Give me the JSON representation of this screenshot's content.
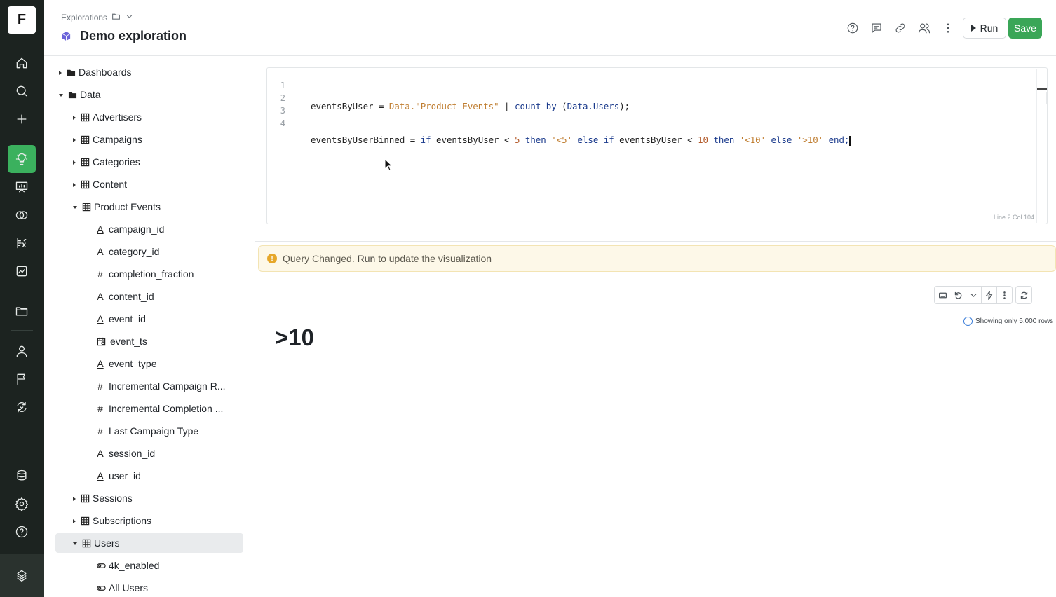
{
  "rail": {
    "logo_letter": "F",
    "items": [
      {
        "name": "home-icon"
      },
      {
        "name": "search-icon"
      },
      {
        "name": "plus-icon"
      },
      {
        "name": "lightbulb-icon",
        "active": true
      },
      {
        "name": "presentation-icon"
      },
      {
        "name": "overlap-icon"
      },
      {
        "name": "formula-icon"
      },
      {
        "name": "chart-icon"
      },
      {
        "name": "folder-icon"
      },
      {
        "name": "user-icon"
      },
      {
        "name": "flag-icon"
      },
      {
        "name": "workflow-icon"
      },
      {
        "name": "database-icon"
      },
      {
        "name": "gear-icon"
      },
      {
        "name": "help-icon"
      },
      {
        "name": "brand-icon"
      }
    ],
    "active_color": "#3bb15e"
  },
  "header": {
    "breadcrumb": "Explorations",
    "title": "Demo exploration",
    "icons": [
      "help-icon",
      "comment-icon",
      "link-icon",
      "users-icon",
      "more-icon"
    ],
    "run_label": "Run",
    "save_label": "Save",
    "save_color": "#3aa657"
  },
  "tree": {
    "rows": [
      {
        "label": "Dashboards",
        "caret": "right",
        "kind": "folder",
        "indent": 0
      },
      {
        "label": "Data",
        "caret": "down",
        "kind": "folder-open",
        "indent": 0
      },
      {
        "label": "Advertisers",
        "caret": "right",
        "kind": "table",
        "indent": 1
      },
      {
        "label": "Campaigns",
        "caret": "right",
        "kind": "table",
        "indent": 1
      },
      {
        "label": "Categories",
        "caret": "right",
        "kind": "table",
        "indent": 1
      },
      {
        "label": "Content",
        "caret": "right",
        "kind": "table",
        "indent": 1
      },
      {
        "label": "Product Events",
        "caret": "down",
        "kind": "table",
        "indent": 1
      },
      {
        "label": "campaign_id",
        "kind": "string",
        "indent": 2
      },
      {
        "label": "category_id",
        "kind": "string",
        "indent": 2
      },
      {
        "label": "completion_fraction",
        "kind": "number",
        "indent": 2
      },
      {
        "label": "content_id",
        "kind": "string",
        "indent": 2
      },
      {
        "label": "event_id",
        "kind": "string",
        "indent": 2
      },
      {
        "label": "event_ts",
        "kind": "datetime",
        "indent": 2
      },
      {
        "label": "event_type",
        "kind": "string",
        "indent": 2
      },
      {
        "label": "Incremental Campaign R...",
        "kind": "number",
        "indent": 2
      },
      {
        "label": "Incremental Completion ...",
        "kind": "number",
        "indent": 2
      },
      {
        "label": "Last Campaign Type",
        "kind": "number",
        "indent": 2
      },
      {
        "label": "session_id",
        "kind": "string",
        "indent": 2
      },
      {
        "label": "user_id",
        "kind": "string",
        "indent": 2
      },
      {
        "label": "Sessions",
        "caret": "right",
        "kind": "table",
        "indent": 1
      },
      {
        "label": "Subscriptions",
        "caret": "right",
        "kind": "table",
        "indent": 1
      },
      {
        "label": "Users",
        "caret": "down",
        "kind": "table",
        "indent": 1,
        "selected": true
      },
      {
        "label": "4k_enabled",
        "kind": "boolean",
        "indent": 2
      },
      {
        "label": "All Users",
        "kind": "boolean",
        "indent": 2
      }
    ]
  },
  "editor": {
    "line_numbers": [
      "1",
      "2",
      "3",
      "4"
    ],
    "line1": {
      "a": "eventsByUser",
      "b": " = ",
      "c": "Data.",
      "d": "\"Product Events\"",
      "e": " | ",
      "f": "count by",
      "g": " (",
      "h": "Data.Users",
      "i": ");"
    },
    "line2": {
      "a": "eventsByUserBinned",
      "b": " = ",
      "c": "if",
      "d": " eventsByUser ",
      "e": "<",
      "f": " 5 ",
      "g": "then",
      "h": " '<5' ",
      "i": "else if",
      "j": " eventsByUser ",
      "k": "<",
      "l": " 10 ",
      "m": "then",
      "n": " '<10' ",
      "o": "else",
      "p": " '>10' ",
      "q": "end;"
    },
    "status": "Line 2 Col 104"
  },
  "notice": {
    "text_before": "Query Changed.",
    "link": "Run",
    "text_after": "to update the visualization"
  },
  "viz": {
    "toolbar_icons": [
      "keyboard-icon",
      "undo-icon",
      "chevron-down-icon",
      "bolt-icon",
      "more-icon",
      "refresh-icon"
    ],
    "rows_info": "Showing only 5,000 rows",
    "value": ">10"
  }
}
